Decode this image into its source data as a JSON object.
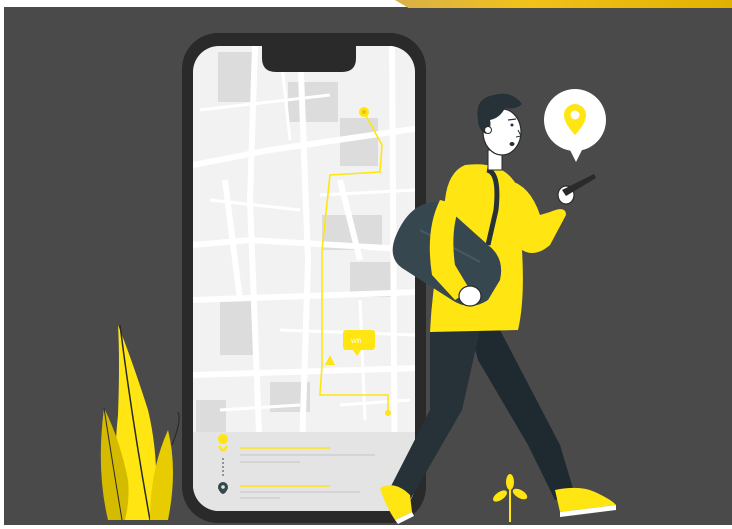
{
  "scene": {
    "colors": {
      "background": "#4a4a4a",
      "accent": "#ffe512",
      "phone_frame": "#2a2a2a",
      "map_base": "#f2f2f2",
      "map_block": "#dcdcdc",
      "pants": "#263238",
      "bag": "#37474f"
    },
    "icons": [
      "location-pin-icon",
      "map-pin-icon",
      "smartphone-icon"
    ],
    "map_tag_text": "Wifi"
  }
}
